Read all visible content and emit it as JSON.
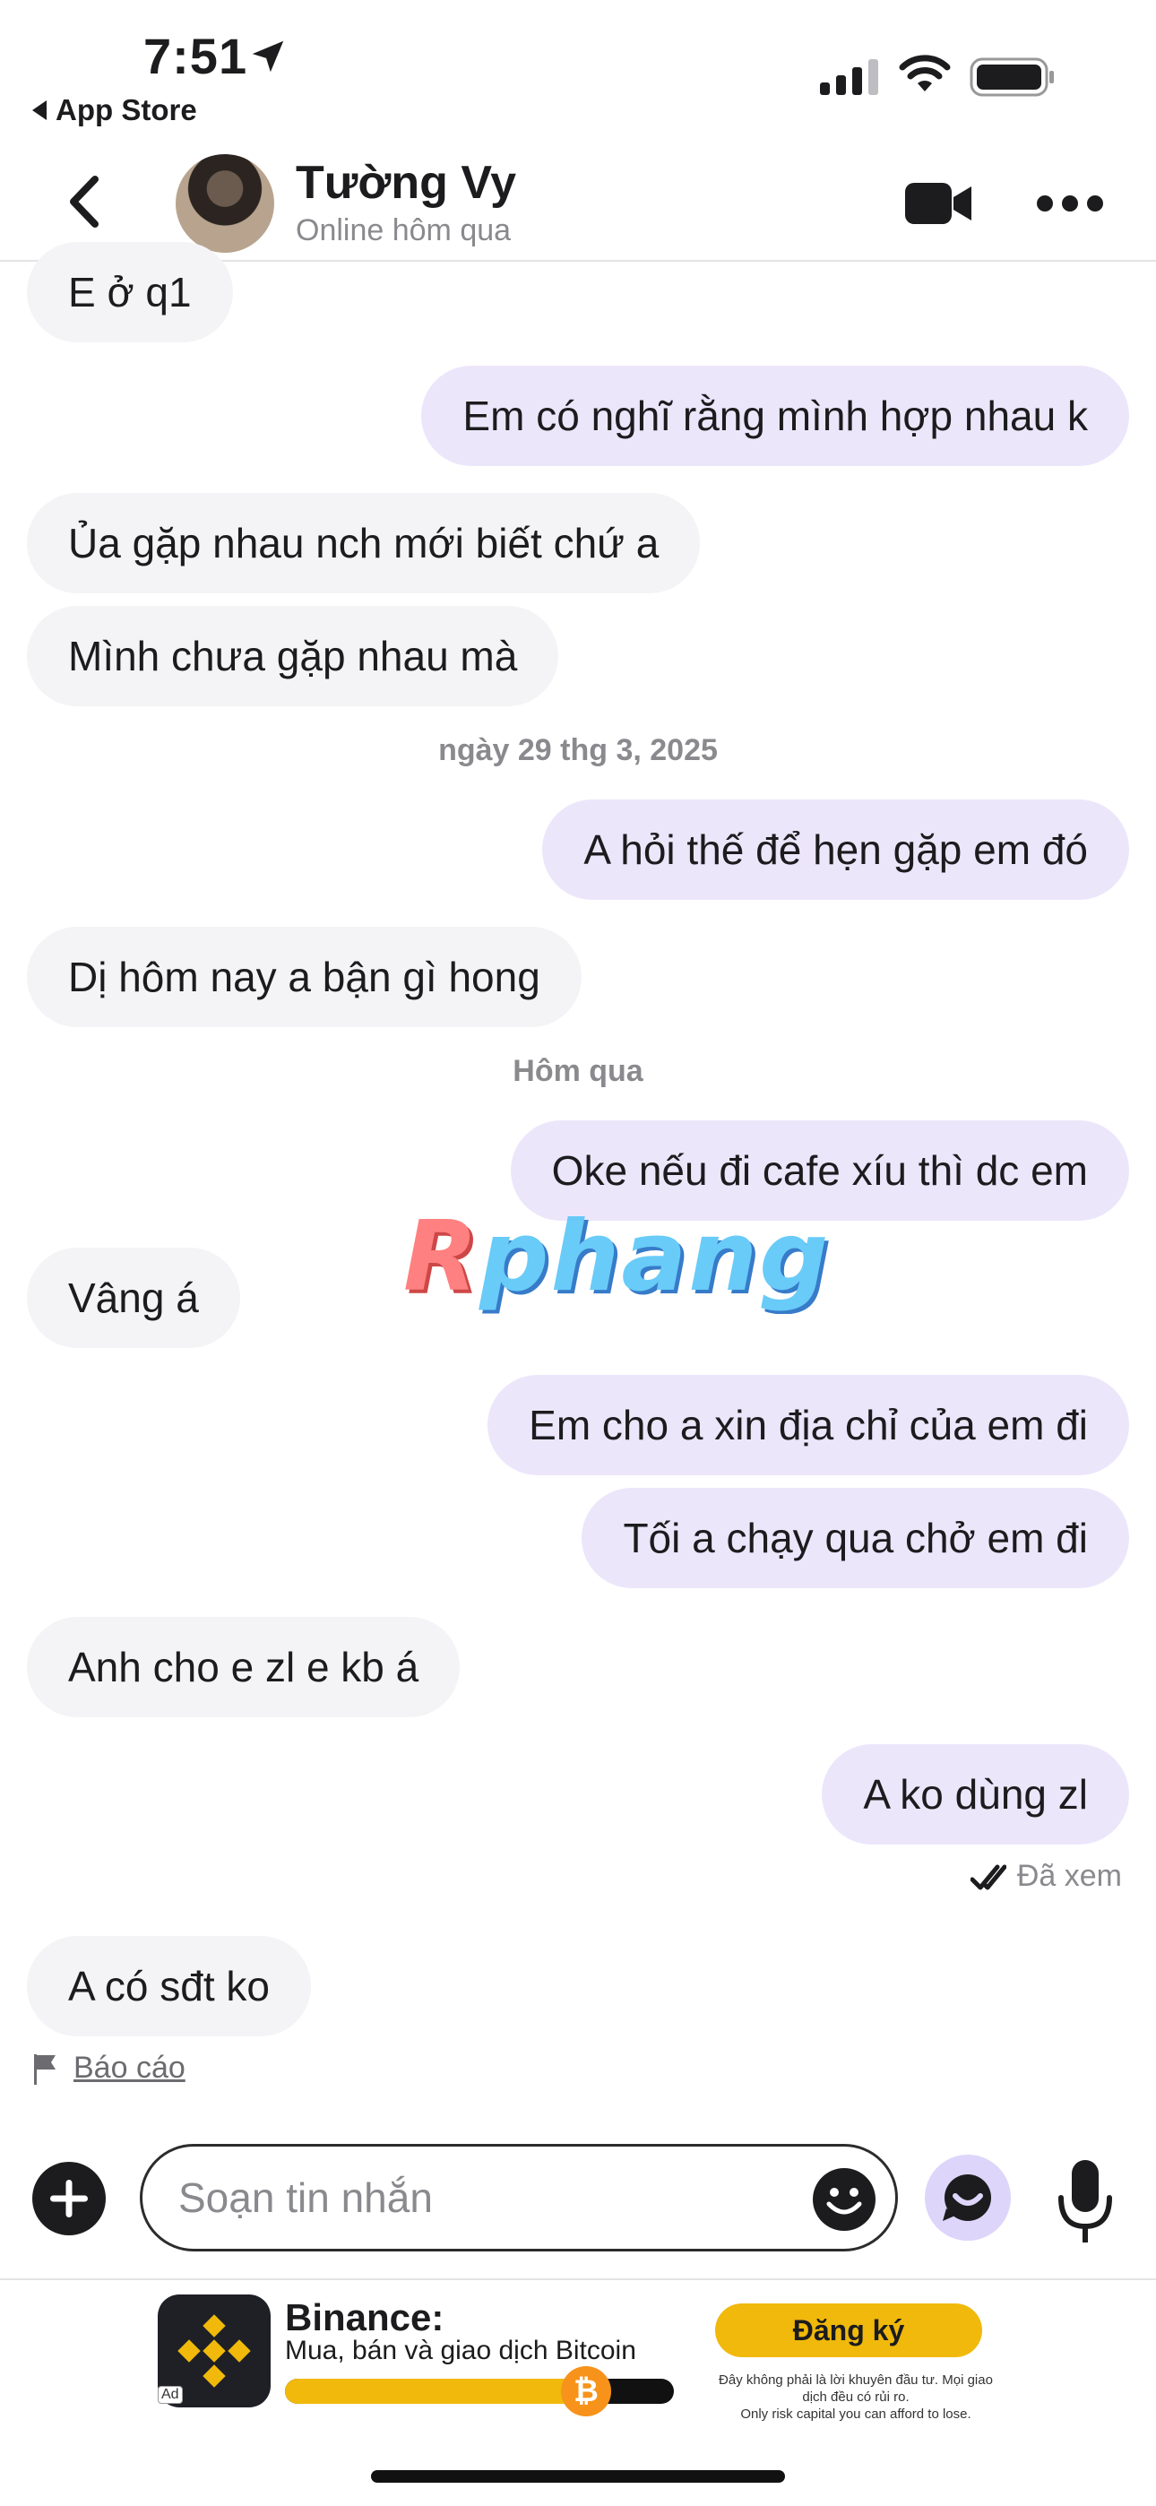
{
  "status_bar": {
    "time": "7:51",
    "back_app": "App Store",
    "icons": [
      "location-arrow-icon",
      "cellular-signal-icon",
      "wifi-icon",
      "battery-icon"
    ]
  },
  "header": {
    "name": "Tường Vy",
    "presence": "Online hôm qua",
    "icons": [
      "back-chevron-icon",
      "video-camera-icon",
      "more-dots-icon"
    ]
  },
  "chat": {
    "messages": [
      {
        "side": "in",
        "text": "E ở q1"
      },
      {
        "side": "out",
        "text": "Em có nghĩ rằng mình hợp nhau k"
      },
      {
        "side": "in",
        "text": "Ủa gặp nhau nch mới biết chứ a"
      },
      {
        "side": "in",
        "text": "Mình chưa gặp nhau mà"
      },
      {
        "side": "out",
        "text": "A hỏi thế để hẹn gặp em đó"
      },
      {
        "side": "in",
        "text": "Dị hôm nay a bận gì hong"
      },
      {
        "side": "out",
        "text": "Oke nếu đi cafe xíu thì dc em"
      },
      {
        "side": "in",
        "text": "Vâng á"
      },
      {
        "side": "out",
        "text": "Em cho a xin địa chỉ của em đi"
      },
      {
        "side": "out",
        "text": "Tối a chạy qua chở em đi"
      },
      {
        "side": "in",
        "text": "Anh cho e zl e kb á"
      },
      {
        "side": "out",
        "text": "A ko dùng zl"
      },
      {
        "side": "in",
        "text": "A có sđt ko"
      }
    ],
    "date_separators": [
      "ngày 29 thg 3, 2025",
      "Hôm qua"
    ],
    "seen_label": "Đã xem",
    "report_label": "Báo cáo",
    "watermark_r": "R",
    "watermark_rest": "phang"
  },
  "composer": {
    "placeholder": "Soạn tin nhắn",
    "icons": [
      "plus-icon",
      "emoji-icon",
      "gif-sticker-icon",
      "microphone-icon"
    ]
  },
  "ad": {
    "title": "Binance:",
    "subtitle": "Mua, bán và giao dịch Bitcoin",
    "cta": "Đăng ký",
    "badge": "Ad",
    "coin_symbol": "₿",
    "progress": 0.82,
    "disclaimer_1": "Đây không phải là lời khuyên đầu tư. Mọi giao dịch đều có rủi ro.",
    "disclaimer_2": "Only risk capital you can afford to lose.",
    "colors": {
      "brand": "#f0b90b",
      "logo_bg": "#1e2026"
    }
  }
}
